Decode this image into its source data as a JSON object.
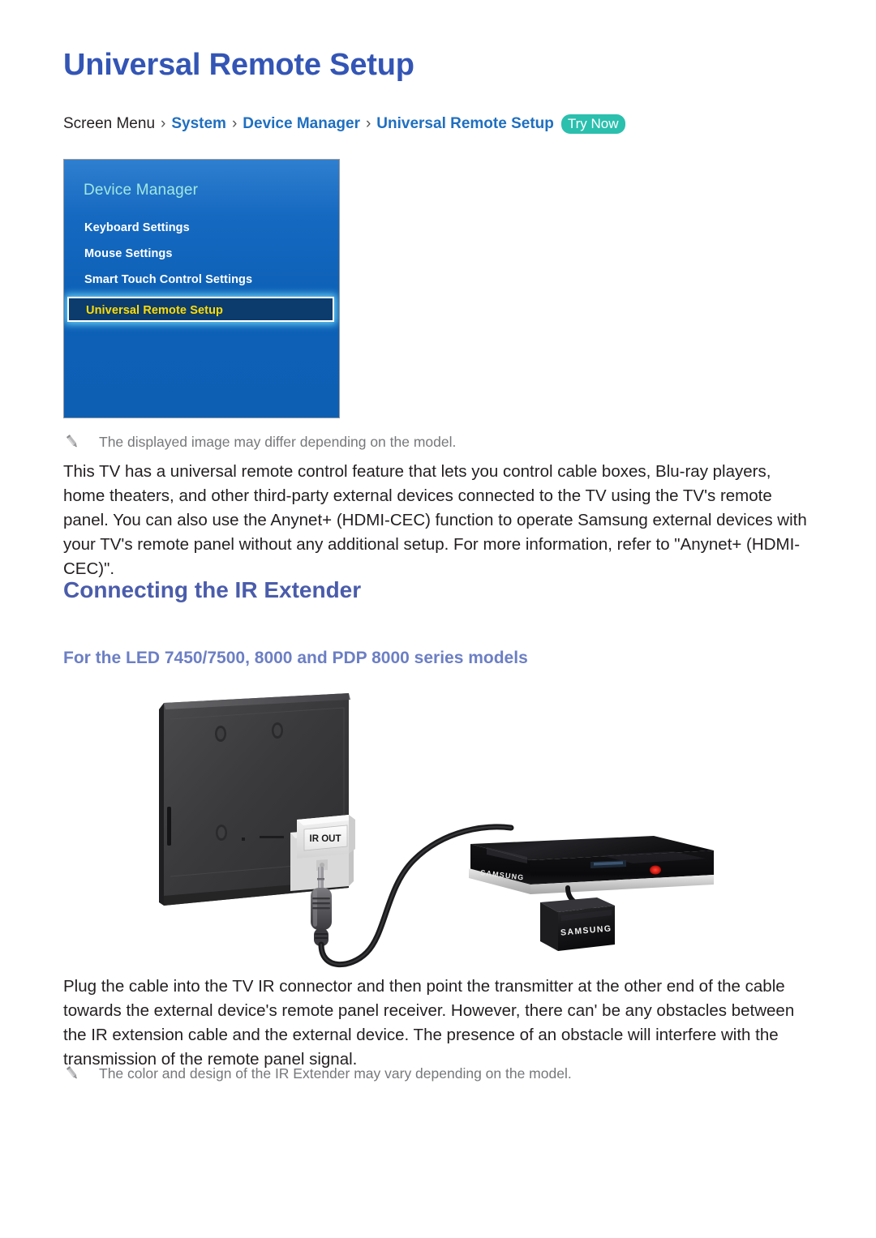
{
  "page": {
    "title": "Universal Remote Setup"
  },
  "breadcrumb": {
    "root": "Screen Menu",
    "separator": "›",
    "items": [
      "System",
      "Device Manager",
      "Universal Remote Setup"
    ],
    "badge": "Try Now"
  },
  "tv_menu": {
    "title": "Device Manager",
    "items": [
      {
        "label": "Keyboard Settings",
        "selected": false
      },
      {
        "label": "Mouse Settings",
        "selected": false
      },
      {
        "label": "Smart Touch Control Settings",
        "selected": false
      },
      {
        "label": "Universal Remote Setup",
        "selected": true
      }
    ],
    "colors": {
      "panel_top": "#2f7fd0",
      "panel_bottom": "#0d5fb4",
      "title_text": "#9fe8e0",
      "item_text": "#ffffff",
      "selected_bg": "#0c3b6e",
      "selected_text": "#ffdd00",
      "selected_border": "#ffffff",
      "selected_glow": "#78e1ff"
    }
  },
  "notes": {
    "note_1": "The displayed image may differ depending on the model.",
    "note_2": "The color and design of the IR Extender may vary depending on the model."
  },
  "paragraphs": {
    "intro": "This TV has a universal remote control feature that lets you control cable boxes, Blu-ray players, home theaters, and other third-party external devices connected to the TV using the TV's remote panel. You can also use the Anynet+ (HDMI-CEC) function to operate Samsung external devices with your TV's remote panel without any additional setup. For more information, refer to \"Anynet+ (HDMI-CEC)\".",
    "instructions": "Plug the cable into the TV IR connector and then point the transmitter at the other end of the cable towards the external device's remote panel receiver. However, there can' be any obstacles between the IR extension cable and the external device. The presence of an obstacle will interfere with the transmission of the remote panel signal."
  },
  "headings": {
    "h2": "Connecting the IR Extender",
    "h3": "For the LED 7450/7500, 8000 and PDP 8000 series models"
  },
  "illustration": {
    "ir_out_label": "IR OUT",
    "player_brand": "SAMSUNG",
    "transmitter_brand": "SAMSUNG",
    "led_color": "#e02020"
  },
  "colors": {
    "title_blue": "#3355b5",
    "link_blue": "#1f6fc0",
    "badge_teal": "#2bbfae",
    "heading_blue": "#4a5cab",
    "subheading_blue": "#6c7fc4",
    "note_gray": "#77787b",
    "body_black": "#231f20"
  }
}
